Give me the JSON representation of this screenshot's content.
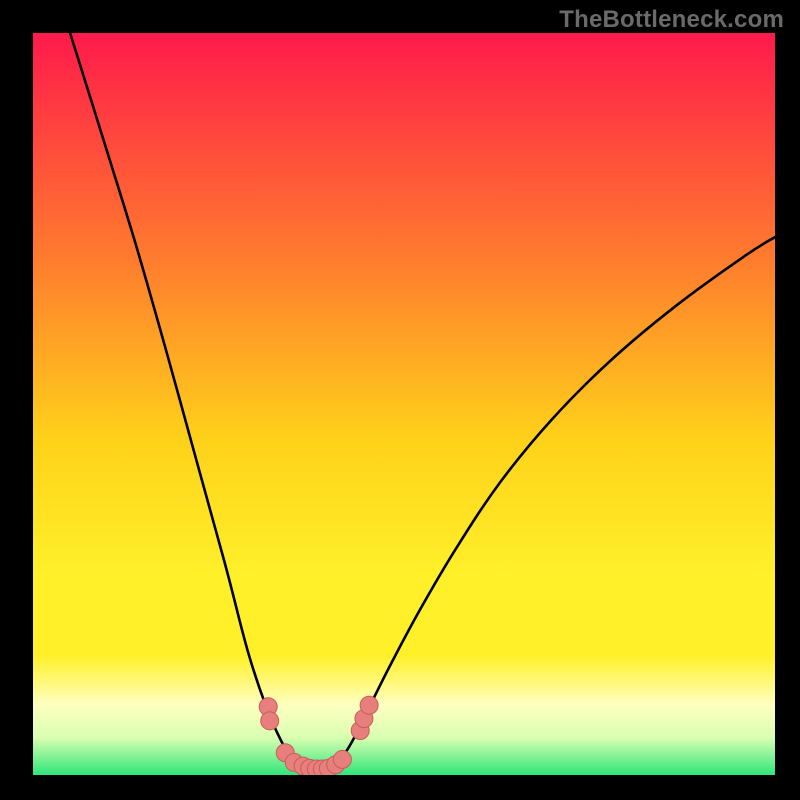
{
  "watermark": "TheBottleneck.com",
  "colors": {
    "black": "#000000",
    "curve": "#000000",
    "marker_fill": "#e77f7d",
    "marker_stroke": "#c95d5b",
    "grad_top": "#ff1a4b",
    "grad_mid_upper": "#ff7a2e",
    "grad_mid": "#ffd21a",
    "grad_mid_lower": "#fff02a",
    "grad_pale": "#ffffc0",
    "grad_green": "#2fe57a"
  },
  "chart_data": {
    "type": "line",
    "title": "",
    "xlabel": "",
    "ylabel": "",
    "xlim": [
      0,
      100
    ],
    "ylim": [
      0,
      100
    ],
    "grid": false,
    "curve": {
      "comment": "V-shaped bottleneck curve. Values are read off the plotted line relative to the 742x742 plot area, expressed as percentages (x from left, y = bottleneck %).",
      "x_pct": [
        5,
        10,
        14,
        18,
        22,
        26,
        29,
        31.5,
        33.5,
        35,
        36.5,
        37.9,
        39,
        40,
        41.5,
        43,
        45,
        48,
        52,
        57,
        63,
        70,
        78,
        87,
        96,
        100
      ],
      "y_pct": [
        100,
        84,
        71,
        57,
        42.5,
        28,
        16.5,
        9,
        4.5,
        2.2,
        1.1,
        0.7,
        0.7,
        1.0,
        2.2,
        4.5,
        8.5,
        14.5,
        22,
        30.5,
        39.5,
        48,
        56,
        63.5,
        70,
        72.5
      ]
    },
    "markers": {
      "comment": "Salmon-colored discrete sample points near the valley, as (x_pct, y_pct).",
      "points": [
        [
          31.7,
          9.2
        ],
        [
          31.9,
          7.3
        ],
        [
          34.0,
          3.0
        ],
        [
          35.2,
          1.7
        ],
        [
          36.4,
          1.2
        ],
        [
          37.3,
          0.9
        ],
        [
          38.2,
          0.8
        ],
        [
          39.0,
          0.8
        ],
        [
          39.8,
          0.9
        ],
        [
          40.8,
          1.4
        ],
        [
          41.7,
          2.1
        ],
        [
          44.1,
          6.0
        ],
        [
          44.6,
          7.6
        ],
        [
          45.3,
          9.4
        ]
      ]
    }
  }
}
